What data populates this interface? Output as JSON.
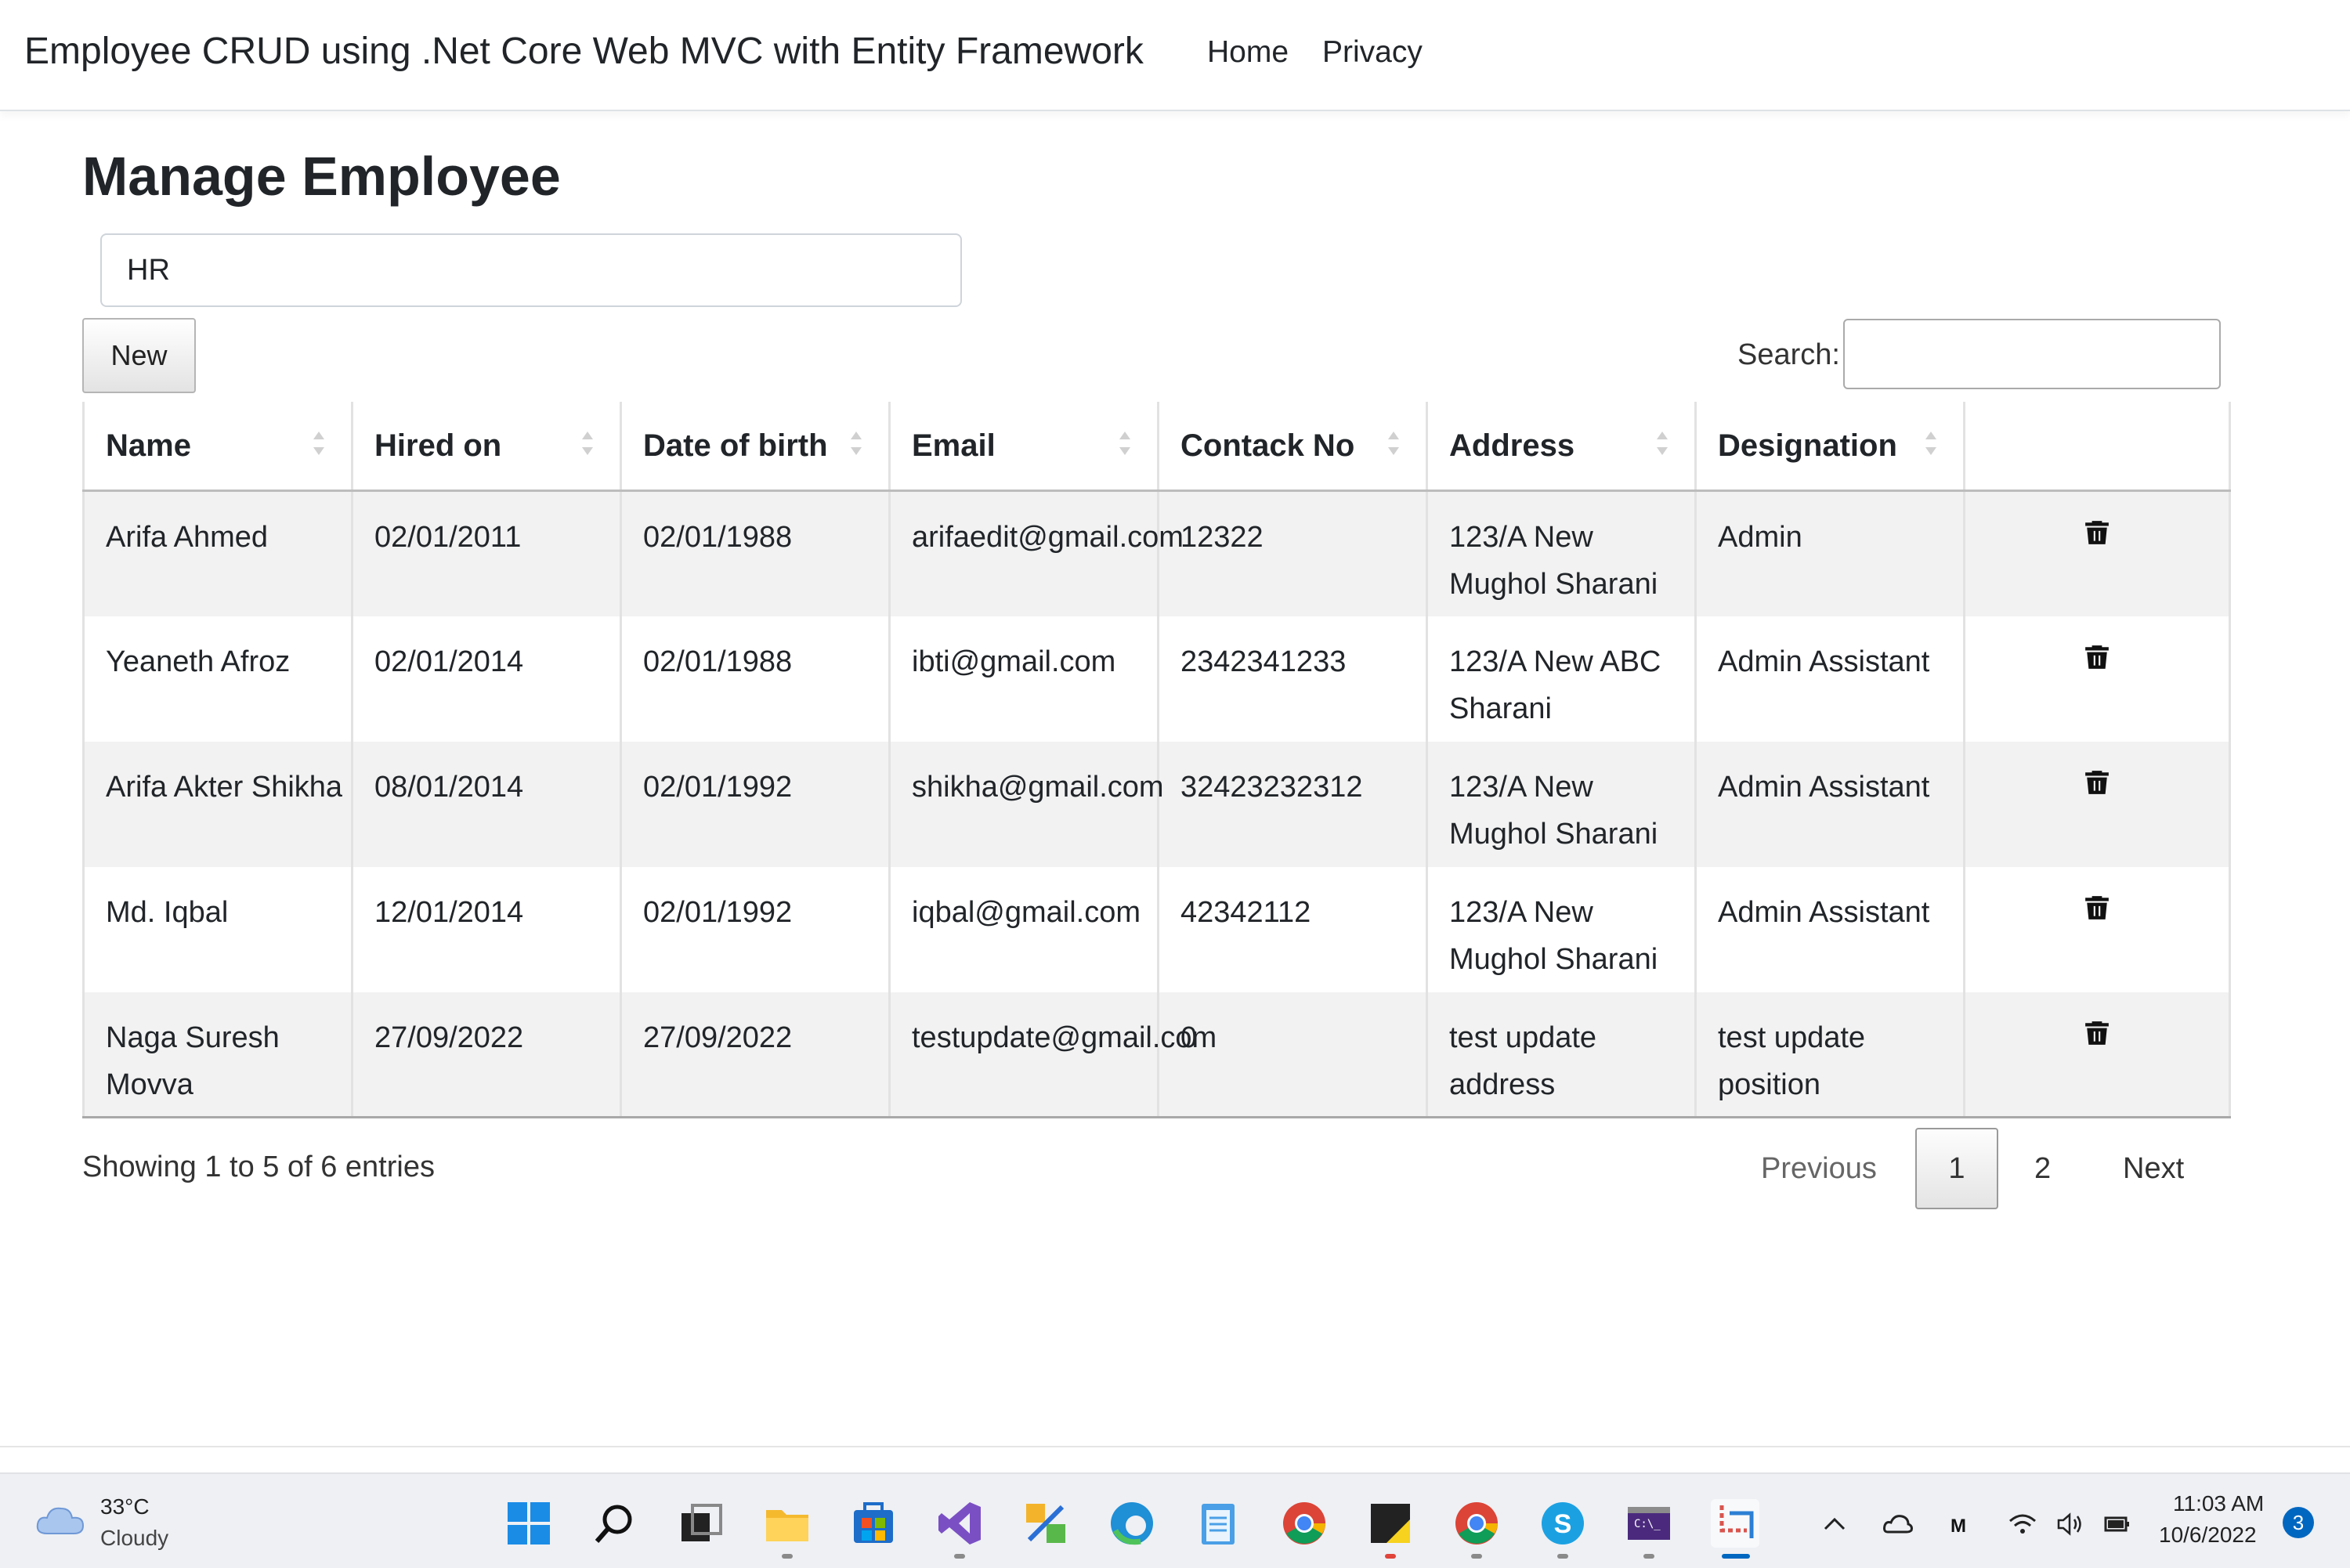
{
  "navbar": {
    "brand": "Employee CRUD using .Net Core Web MVC with Entity Framework",
    "links": [
      "Home",
      "Privacy"
    ]
  },
  "page": {
    "title": "Manage Employee",
    "department_value": "HR",
    "new_button": "New",
    "search_label": "Search:",
    "search_value": ""
  },
  "table": {
    "headers": [
      "Name",
      "Hired on",
      "Date of birth",
      "Email",
      "Contack No",
      "Address",
      "Designation"
    ],
    "rows": [
      [
        "Arifa Ahmed",
        "02/01/2011",
        "02/01/1988",
        "arifaedit@gmail.com",
        "12322",
        "123/A New Mughol Sharani",
        "Admin"
      ],
      [
        "Yeaneth Afroz",
        "02/01/2014",
        "02/01/1988",
        "ibti@gmail.com",
        "2342341233",
        "123/A New ABC Sharani",
        "Admin Assistant"
      ],
      [
        "Arifa Akter Shikha",
        "08/01/2014",
        "02/01/1992",
        "shikha@gmail.com",
        "32423232312",
        "123/A New Mughol Sharani",
        "Admin Assistant"
      ],
      [
        "Md. Iqbal",
        "12/01/2014",
        "02/01/1992",
        "iqbal@gmail.com",
        "42342112",
        "123/A New Mughol Sharani",
        "Admin Assistant"
      ],
      [
        "Naga Suresh Movva",
        "27/09/2022",
        "27/09/2022",
        "testupdate@gmail.com",
        "0",
        "test update address",
        "test update position"
      ]
    ]
  },
  "pagination": {
    "info": "Showing 1 to 5 of 6 entries",
    "previous": "Previous",
    "pages": [
      "1",
      "2"
    ],
    "current_page": "1",
    "next": "Next"
  },
  "taskbar": {
    "weather_temp": "33°C",
    "weather_desc": "Cloudy",
    "clock_time": "11:03 AM",
    "clock_date": "10/6/2022",
    "notification_count": "3",
    "apps": [
      "windows-start-icon",
      "search-icon",
      "task-view-icon",
      "file-explorer-icon",
      "microsoft-store-icon",
      "visual-studio-icon",
      "paint-tools-icon",
      "edge-icon",
      "notepad-icon",
      "chrome-icon",
      "sticky-notes-icon",
      "chrome-profile-icon",
      "skype-icon",
      "terminal-icon",
      "snipping-tool-icon"
    ]
  },
  "colors": {
    "accent": "#0067c0",
    "striped_row": "#f2f2f2"
  }
}
